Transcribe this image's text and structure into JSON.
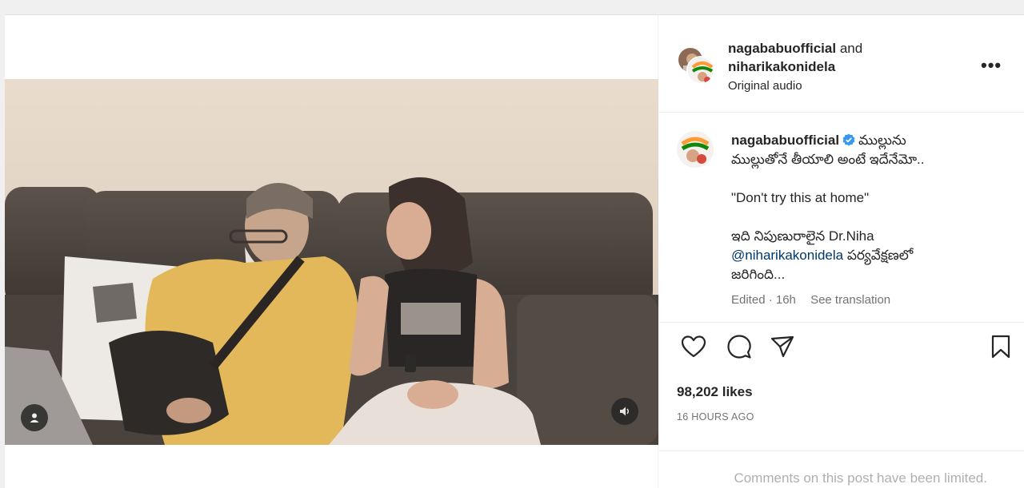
{
  "header": {
    "user_primary": "nagababuofficial",
    "joiner": "and",
    "user_secondary": "niharikakonidela",
    "audio": "Original audio",
    "more_glyph": "•••"
  },
  "caption": {
    "username": "nagababuofficial",
    "line1": "ముల్లును",
    "line2": "ముల్లుతోనే తీయాలి అంటే ఇదేనేమో..",
    "quote": "\"Don't try this at home\"",
    "line3": "ఇది నిపుణురాలైన Dr.Niha",
    "mention": "@niharikakonidela",
    "line4_rest": " పర్యవేక్షణలో",
    "line5": "జరిగింది...",
    "edited": "Edited · 16h",
    "translate": "See translation"
  },
  "stats": {
    "likes": "98,202 likes",
    "time_ago": "16 HOURS AGO"
  },
  "comments": {
    "limited_text": "Comments on this post have been limited."
  },
  "icons": {
    "like": "heart-icon",
    "comment": "comment-icon",
    "share": "send-icon",
    "save": "bookmark-icon",
    "sound": "speaker-icon",
    "tagged": "user-icon",
    "verified": "verified-badge-icon"
  },
  "colors": {
    "verified": "#3897f0",
    "mention": "#00376b",
    "muted": "#737373"
  }
}
